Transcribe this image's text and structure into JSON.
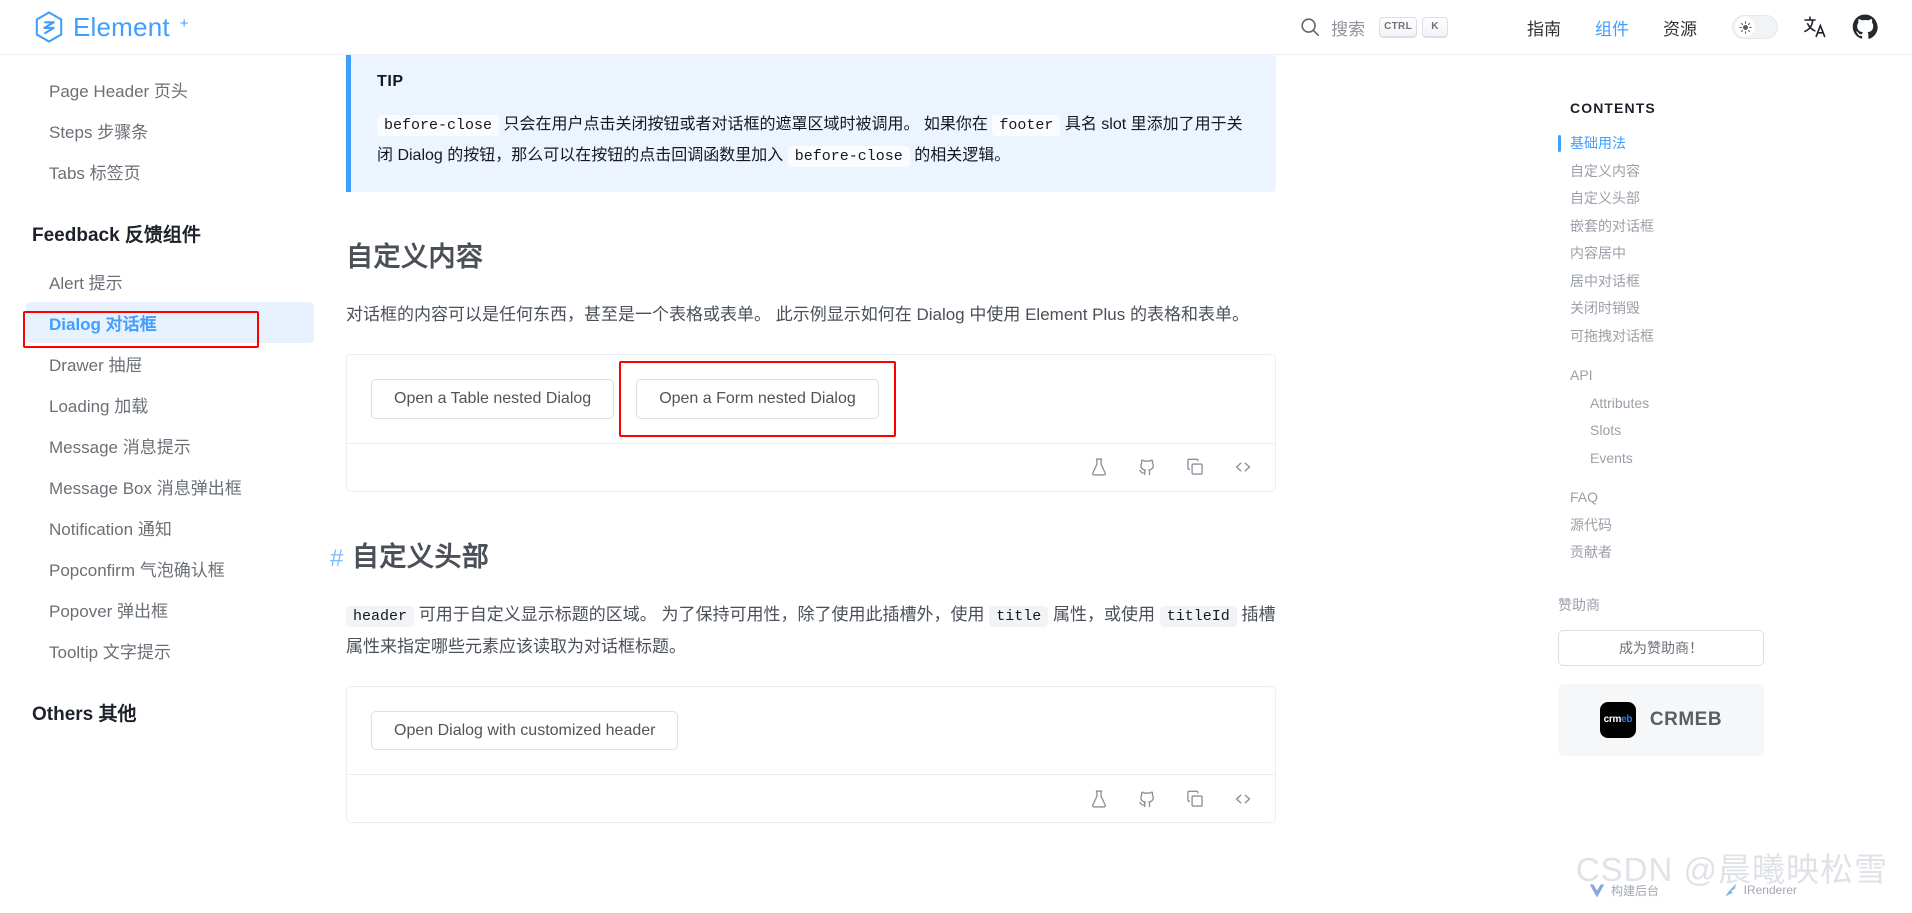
{
  "header": {
    "brand": "Element",
    "brand_plus": "+",
    "logo_icon": "element-hexagon-logo",
    "search": {
      "label": "搜索",
      "icon": "search-icon",
      "kbd1": "CTRL",
      "kbd2": "K"
    },
    "nav": [
      {
        "label": "指南",
        "active": false
      },
      {
        "label": "组件",
        "active": true
      },
      {
        "label": "资源",
        "active": false
      }
    ],
    "theme_toggle_icon": "sun-icon",
    "lang_icon": "translate-icon",
    "github_icon": "github-icon"
  },
  "sidebar": {
    "items_top": [
      {
        "label": "Page Header 页头"
      },
      {
        "label": "Steps 步骤条"
      },
      {
        "label": "Tabs 标签页"
      }
    ],
    "group_title": "Feedback 反馈组件",
    "items_feedback": [
      {
        "label": "Alert 提示",
        "active": false
      },
      {
        "label": "Dialog 对话框",
        "active": true
      },
      {
        "label": "Drawer 抽屉",
        "active": false
      },
      {
        "label": "Loading 加载",
        "active": false
      },
      {
        "label": "Message 消息提示",
        "active": false
      },
      {
        "label": "Message Box 消息弹出框",
        "active": false
      },
      {
        "label": "Notification 通知",
        "active": false
      },
      {
        "label": "Popconfirm 气泡确认框",
        "active": false
      },
      {
        "label": "Popover 弹出框",
        "active": false
      },
      {
        "label": "Tooltip 文字提示",
        "active": false
      }
    ],
    "group_title_2": "Others 其他"
  },
  "tip": {
    "title": "TIP",
    "code1": "before-close",
    "text1": "只会在用户点击关闭按钮或者对话框的遮罩区域时被调用。 如果你在",
    "code2": "footer",
    "text2": "具名 slot 里添加了用于关闭 Dialog 的按钮，那么可以在按钮的点击回调函数里加入",
    "code3": "before-close",
    "text3": "的相关逻辑。"
  },
  "section_custom_content": {
    "heading": "自定义内容",
    "paragraph": "对话框的内容可以是任何东西，甚至是一个表格或表单。 此示例显示如何在 Dialog 中使用 Element Plus 的表格和表单。",
    "buttons": [
      {
        "label": "Open a Table nested Dialog",
        "highlighted": false
      },
      {
        "label": "Open a Form nested Dialog",
        "highlighted": true
      }
    ],
    "toolbar_icons": [
      "flask-icon",
      "github-icon",
      "copy-icon",
      "code-icon"
    ]
  },
  "section_custom_header": {
    "anchor": "#",
    "heading": "自定义头部",
    "code1": "header",
    "text1": "可用于自定义显示标题的区域。 为了保持可用性，除了使用此插槽外，使用",
    "code2": "title",
    "text2": "属性，或使用",
    "code3": "titleId",
    "text3": "插槽属性来指定哪些元素应该读取为对话框标题。",
    "buttons": [
      {
        "label": "Open Dialog with customized header",
        "highlighted": false
      }
    ],
    "toolbar_icons": [
      "flask-icon",
      "github-icon",
      "copy-icon",
      "code-icon"
    ]
  },
  "right_rail": {
    "title": "CONTENTS",
    "items": [
      {
        "label": "基础用法",
        "active": true,
        "level": 1
      },
      {
        "label": "自定义内容",
        "active": false,
        "level": 1
      },
      {
        "label": "自定义头部",
        "active": false,
        "level": 1
      },
      {
        "label": "嵌套的对话框",
        "active": false,
        "level": 1
      },
      {
        "label": "内容居中",
        "active": false,
        "level": 1
      },
      {
        "label": "居中对话框",
        "active": false,
        "level": 1
      },
      {
        "label": "关闭时销毁",
        "active": false,
        "level": 1
      },
      {
        "label": "可拖拽对话框",
        "active": false,
        "level": 1
      },
      {
        "label": "API",
        "active": false,
        "level": 1
      },
      {
        "label": "Attributes",
        "active": false,
        "level": 2
      },
      {
        "label": "Slots",
        "active": false,
        "level": 2
      },
      {
        "label": "Events",
        "active": false,
        "level": 2
      },
      {
        "label": "FAQ",
        "active": false,
        "level": 1
      },
      {
        "label": "源代码",
        "active": false,
        "level": 1
      },
      {
        "label": "贡献者",
        "active": false,
        "level": 1
      }
    ],
    "sponsor_label": "赞助商",
    "sponsor_button": "成为赞助商！",
    "sponsor_card": {
      "logo_text": "crmeb",
      "name": "CRMEB"
    }
  },
  "watermarks": {
    "main": "CSDN @晨曦映松雪",
    "badge_left": "构建后台",
    "badge_right": "IRenderer"
  },
  "colors": {
    "accent": "#409eff",
    "tip_bg": "#ecf5ff",
    "highlight": "#ff0000",
    "text": "#4b5058",
    "muted": "#9ba0a8"
  }
}
